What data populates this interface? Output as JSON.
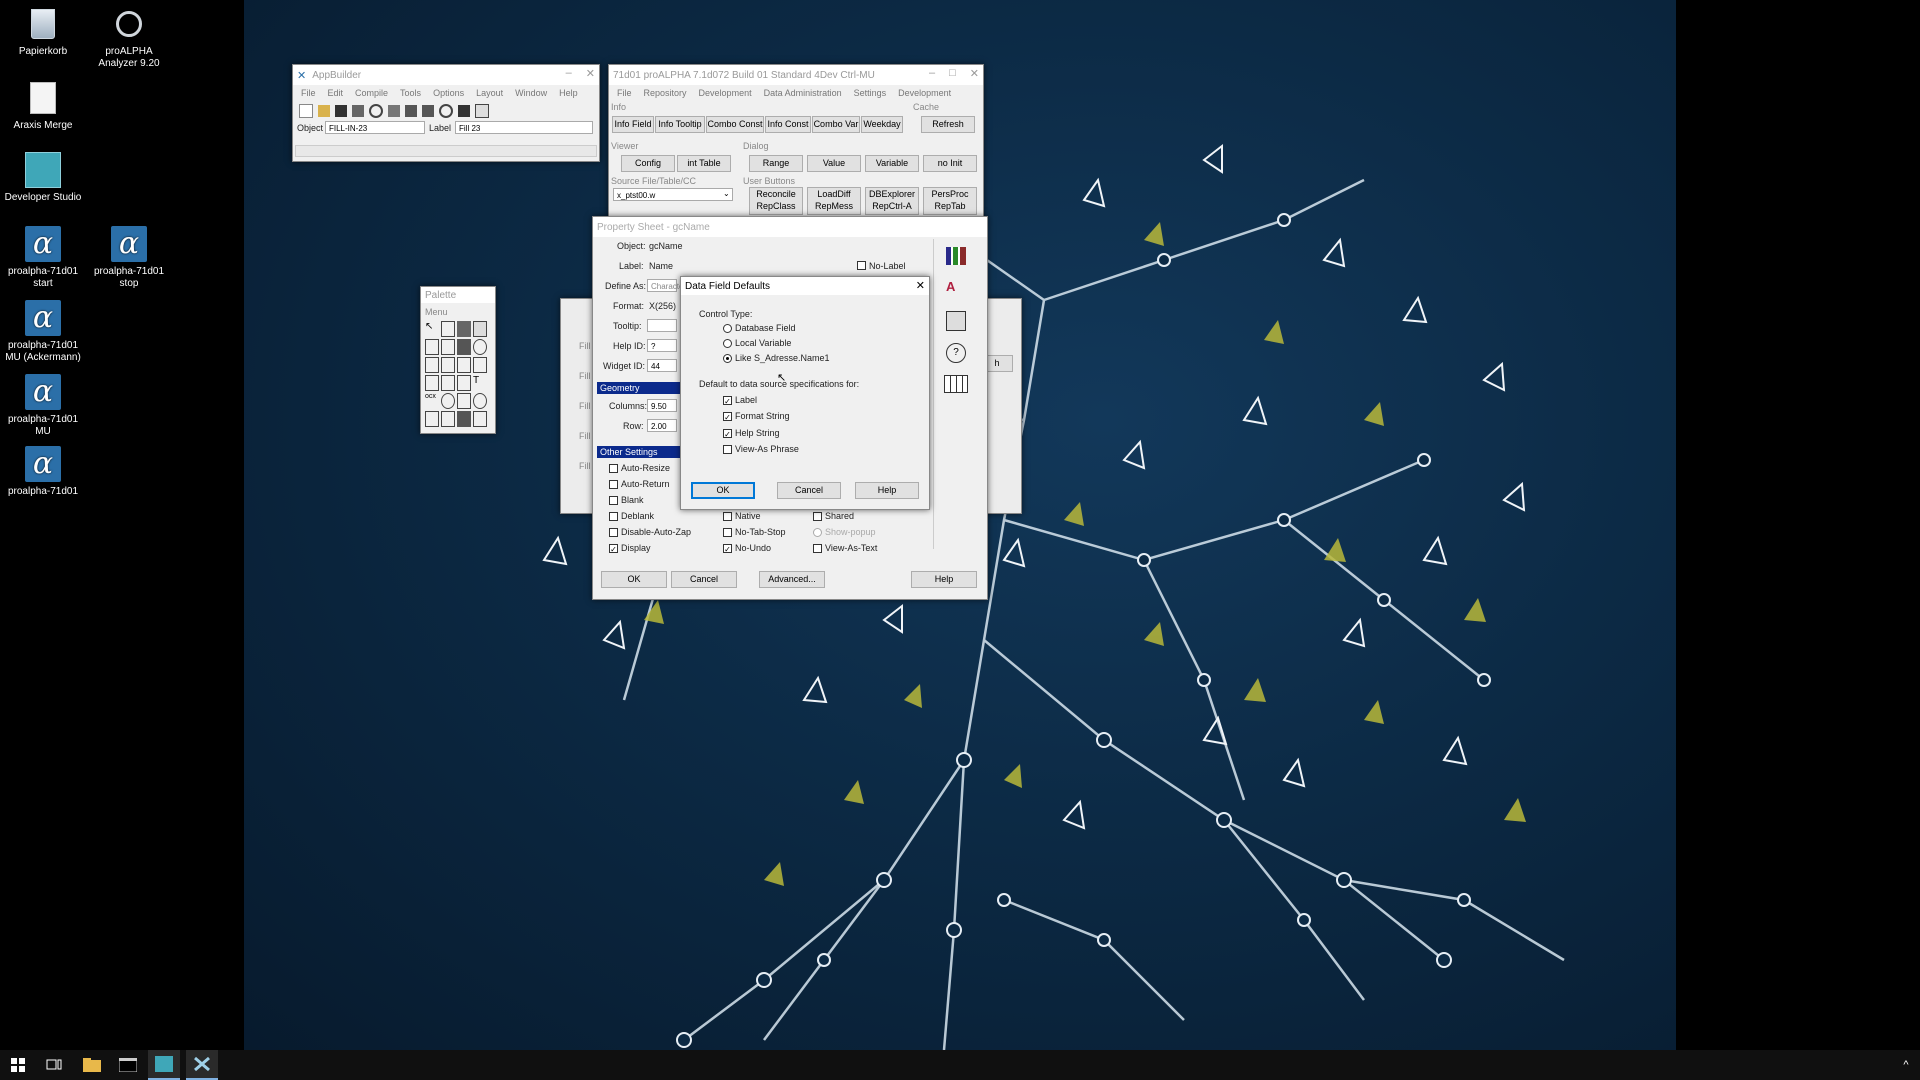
{
  "desktop": {
    "icons": [
      {
        "label": "Papierkorb"
      },
      {
        "label": "proALPHA Analyzer 9.20"
      },
      {
        "label": "Araxis Merge"
      },
      {
        "label": "Developer Studio"
      },
      {
        "label": "proalpha-71d01 start"
      },
      {
        "label": "proalpha-71d01 stop"
      },
      {
        "label": "proalpha-71d01 MU (Ackermann)"
      },
      {
        "label": "proalpha-71d01 MU"
      },
      {
        "label": "proalpha-71d01"
      }
    ],
    "alpha_glyph": "α"
  },
  "appbuilder": {
    "title": "AppBuilder",
    "menu": [
      "File",
      "Edit",
      "Compile",
      "Tools",
      "Options",
      "Layout",
      "Window",
      "Help"
    ],
    "object_label": "Object",
    "object_value": "FILL-IN-23",
    "label_label": "Label",
    "label_value": "Fill 23"
  },
  "pa_window": {
    "title": "71d01 proALPHA 7.1d072 Build 01 Standard 4Dev Ctrl-MU",
    "menu": [
      "File",
      "Repository",
      "Development",
      "Data Administration",
      "Settings",
      "Development"
    ],
    "info_group": "Info",
    "cache_group": "Cache",
    "info_buttons": [
      "Info Field",
      "Info Tooltip",
      "Combo Const",
      "Info Const",
      "Combo Var",
      "Weekday"
    ],
    "refresh": "Refresh",
    "viewer_group": "Viewer",
    "dialog_group": "Dialog",
    "viewer_buttons": [
      "Config",
      "int Table"
    ],
    "dialog_buttons": [
      "Range",
      "Value",
      "Variable",
      "no Init"
    ],
    "source_group": "Source File/Table/CC",
    "user_group": "User Buttons",
    "source_value": "x_ptst00.w",
    "user_buttons": [
      [
        "Reconcile",
        "RepClass"
      ],
      [
        "LoadDiff",
        "RepMess"
      ],
      [
        "DBExplorer",
        "RepCtrl-A"
      ],
      [
        "PersProc",
        "RepTab"
      ]
    ]
  },
  "palette": {
    "title": "Palette",
    "menu": "Menu"
  },
  "property_sheet": {
    "title": "Property Sheet - gcName",
    "object_label": "Object:",
    "object_value": "gcName",
    "label_label": "Label:",
    "label_value": "Name",
    "no_label": "No-Label",
    "define_as_label": "Define As:",
    "define_as_value": "Character",
    "format_label": "Format:",
    "format_value": "X(256)",
    "tooltip_label": "Tooltip:",
    "helpid_label": "Help ID:",
    "helpid_value": "?",
    "widgetid_label": "Widget ID:",
    "widgetid_value": "44",
    "geometry_header": "Geometry",
    "columns_label": "Columns:",
    "columns_value": "9.50",
    "row_label": "Row:",
    "row_value": "2.00",
    "other_header": "Other Settings",
    "col1": [
      {
        "label": "Auto-Resize",
        "checked": false
      },
      {
        "label": "Auto-Return",
        "checked": false
      },
      {
        "label": "Blank",
        "checked": false
      },
      {
        "label": "Deblank",
        "checked": false
      },
      {
        "label": "Disable-Auto-Zap",
        "checked": false
      },
      {
        "label": "Display",
        "checked": true
      }
    ],
    "col2": [
      {
        "label": "Native",
        "checked": false
      },
      {
        "label": "No-Tab-Stop",
        "checked": false
      },
      {
        "label": "No-Undo",
        "checked": true
      }
    ],
    "col3": [
      {
        "label": "Shared",
        "checked": false
      },
      {
        "label": "Show-popup",
        "checked": false
      },
      {
        "label": "View-As-Text",
        "checked": false
      }
    ],
    "ok": "OK",
    "cancel": "Cancel",
    "advanced": "Advanced...",
    "help": "Help"
  },
  "bg_window": {
    "rows": [
      "Fill",
      "Fill",
      "Fill",
      "Fill",
      "Fill"
    ],
    "btn": "h"
  },
  "dfd": {
    "title": "Data Field Defaults",
    "control_type_label": "Control Type:",
    "radios": [
      {
        "label": "Database Field",
        "selected": false
      },
      {
        "label": "Local Variable",
        "selected": false
      },
      {
        "label": "Like S_Adresse.Name1",
        "selected": true
      }
    ],
    "default_label": "Default to data source specifications for:",
    "checks": [
      {
        "label": "Label",
        "checked": true
      },
      {
        "label": "Format String",
        "checked": true
      },
      {
        "label": "Help String",
        "checked": true
      },
      {
        "label": "View-As Phrase",
        "checked": false
      }
    ],
    "ok": "OK",
    "cancel": "Cancel",
    "help": "Help"
  },
  "taskbar": {
    "start_icon": "windows-start-icon",
    "tray_caret": "^"
  }
}
